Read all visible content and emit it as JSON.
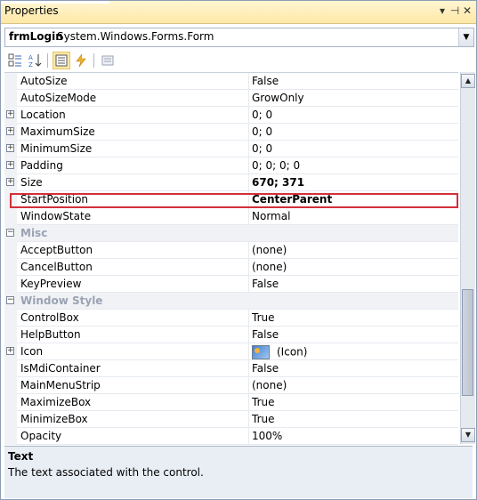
{
  "panel": {
    "title": "Properties",
    "pin_glyph": "▾ ⊣ ✕"
  },
  "object": {
    "name": "frmLogin",
    "type": "System.Windows.Forms.Form"
  },
  "toolbar": {
    "buttons": [
      {
        "name": "categorized-icon"
      },
      {
        "name": "alphabetical-icon"
      },
      {
        "name": "properties-icon",
        "active": true
      },
      {
        "name": "events-icon"
      },
      {
        "name": "property-pages-icon"
      }
    ]
  },
  "rows": [
    {
      "name": "AutoSize",
      "value": "False"
    },
    {
      "name": "AutoSizeMode",
      "value": "GrowOnly"
    },
    {
      "name": "Location",
      "value": "0; 0",
      "expand": true
    },
    {
      "name": "MaximumSize",
      "value": "0; 0",
      "expand": true
    },
    {
      "name": "MinimumSize",
      "value": "0; 0",
      "expand": true
    },
    {
      "name": "Padding",
      "value": "0; 0; 0; 0",
      "expand": true
    },
    {
      "name": "Size",
      "value": "670; 371",
      "expand": true,
      "bold": true
    },
    {
      "name": "StartPosition",
      "value": "CenterParent",
      "bold": true,
      "highlight": true
    },
    {
      "name": "WindowState",
      "value": "Normal"
    },
    {
      "category": "Misc"
    },
    {
      "name": "AcceptButton",
      "value": "(none)"
    },
    {
      "name": "CancelButton",
      "value": "(none)"
    },
    {
      "name": "KeyPreview",
      "value": "False"
    },
    {
      "category": "Window Style"
    },
    {
      "name": "ControlBox",
      "value": "True"
    },
    {
      "name": "HelpButton",
      "value": "False"
    },
    {
      "name": "Icon",
      "value": "(Icon)",
      "expand": true,
      "icon": true
    },
    {
      "name": "IsMdiContainer",
      "value": "False"
    },
    {
      "name": "MainMenuStrip",
      "value": "(none)"
    },
    {
      "name": "MaximizeBox",
      "value": "True"
    },
    {
      "name": "MinimizeBox",
      "value": "True"
    },
    {
      "name": "Opacity",
      "value": "100%"
    }
  ],
  "description": {
    "title": "Text",
    "text": "The text associated with the control."
  }
}
